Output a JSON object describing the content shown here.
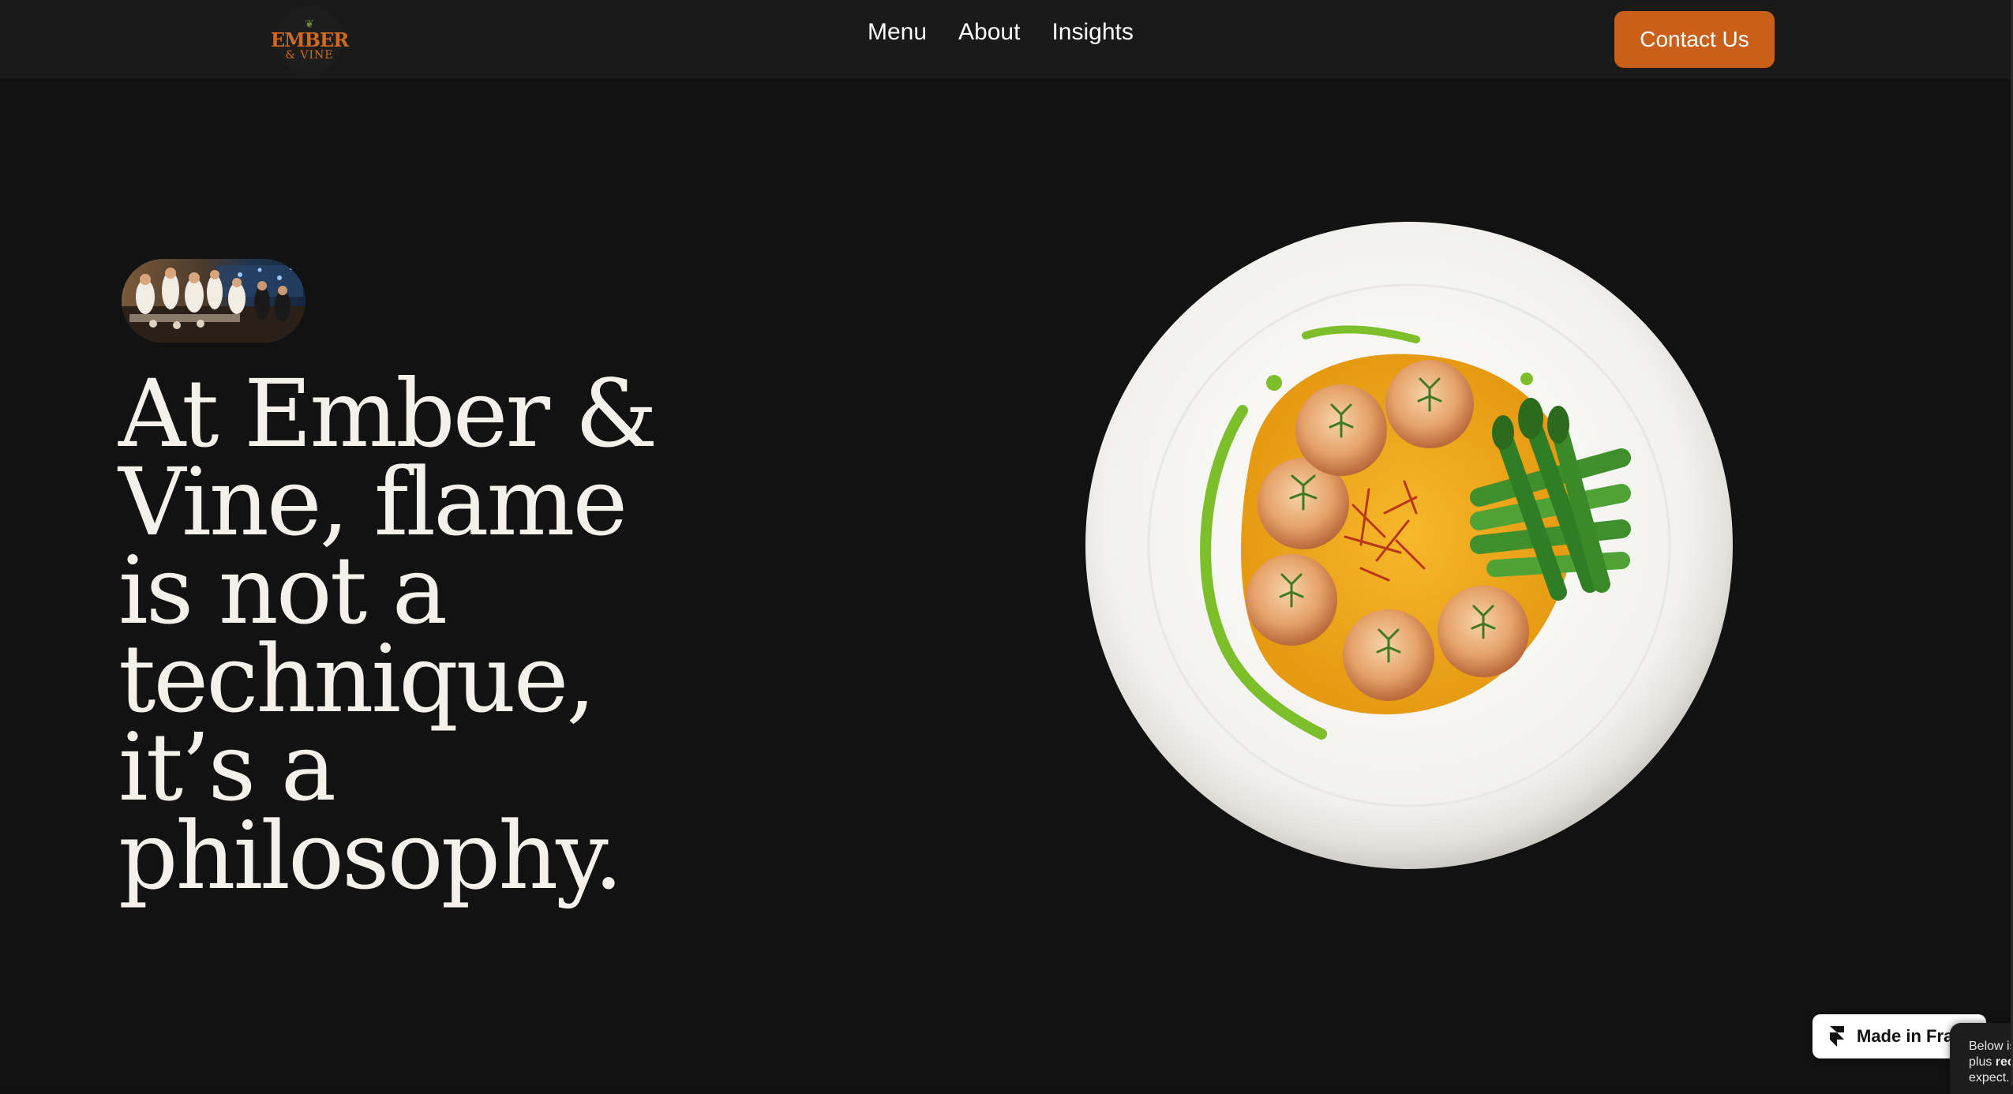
{
  "brand": {
    "logo_main": "EMBER",
    "logo_sub": "& VINE"
  },
  "nav": {
    "items": [
      {
        "label": "Menu"
      },
      {
        "label": "About"
      },
      {
        "label": "Insights"
      }
    ],
    "cta_label": "Contact Us"
  },
  "hero": {
    "headline": "At Ember & Vine, flame is not a technique, it’s a philosophy."
  },
  "badge": {
    "label": "Made in Fram"
  },
  "cookie": {
    "line1": "Below is",
    "line2_prefix": "plus ",
    "line2_bold": "rec",
    "line3": "expect."
  },
  "colors": {
    "background": "#111111",
    "navbar": "#1a1a1a",
    "accent": "#c95f18",
    "text": "#f3f1ea"
  },
  "icons": {
    "framer": "framer-logo-icon",
    "logo_leaf": "leaf-icon"
  }
}
